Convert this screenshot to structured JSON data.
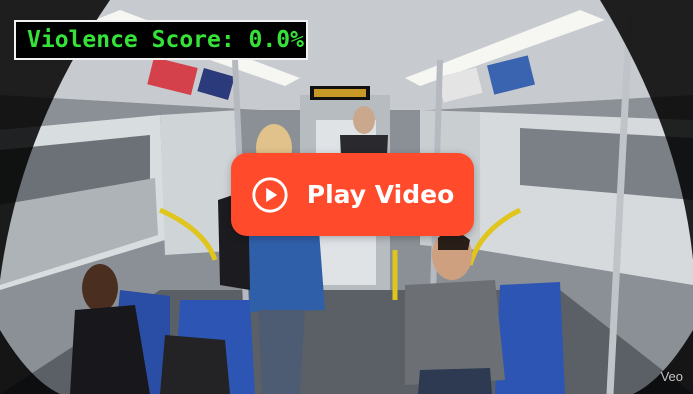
{
  "overlay": {
    "violence_score": "Violence Score: 0.0%"
  },
  "player": {
    "play_label": "Play Video",
    "play_icon": "play-circle-icon",
    "accent_color": "#ff4b2b",
    "score_color": "#36e23a"
  },
  "bus_display": {
    "text": ""
  },
  "watermark": "Veo"
}
